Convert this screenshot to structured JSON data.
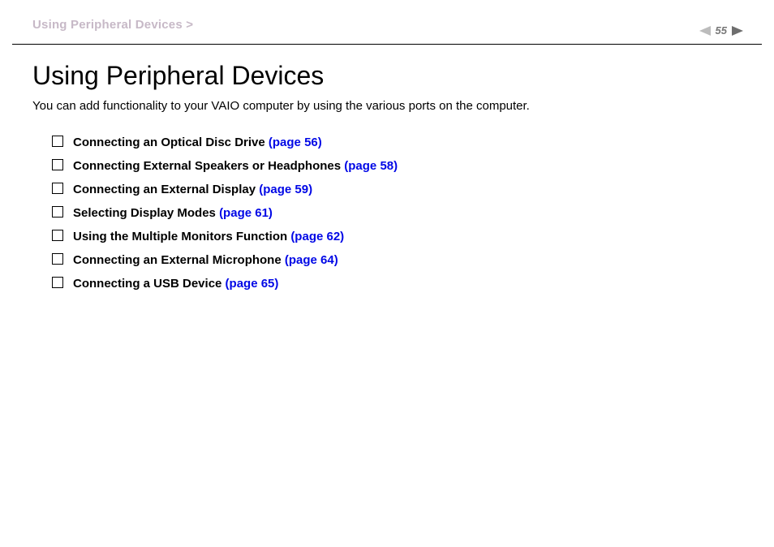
{
  "header": {
    "breadcrumb": "Using Peripheral Devices >",
    "page_number": "55"
  },
  "page": {
    "title": "Using Peripheral Devices",
    "intro": "You can add functionality to your VAIO computer by using the various ports on the computer."
  },
  "toc": [
    {
      "label": "Connecting an Optical Disc Drive ",
      "page_ref": "(page 56)"
    },
    {
      "label": "Connecting External Speakers or Headphones ",
      "page_ref": "(page 58)"
    },
    {
      "label": "Connecting an External Display ",
      "page_ref": "(page 59)"
    },
    {
      "label": "Selecting Display Modes ",
      "page_ref": "(page 61)"
    },
    {
      "label": "Using the Multiple Monitors Function ",
      "page_ref": "(page 62)"
    },
    {
      "label": "Connecting an External Microphone ",
      "page_ref": "(page 64)"
    },
    {
      "label": "Connecting a USB Device ",
      "page_ref": "(page 65)"
    }
  ]
}
